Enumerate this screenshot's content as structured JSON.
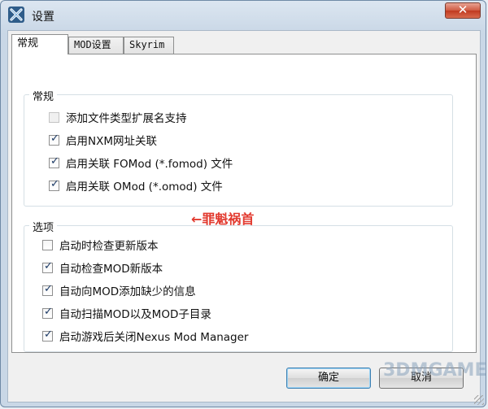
{
  "window": {
    "title": "设置",
    "close_symbol": "✕",
    "icon": "nexus-x-icon"
  },
  "tabs": [
    {
      "label": "常规",
      "active": true
    },
    {
      "label": "MOD设置",
      "active": false
    },
    {
      "label": "Skyrim",
      "active": false
    }
  ],
  "general_group": {
    "title": "常规",
    "items": [
      {
        "label": "添加文件类型扩展名支持",
        "checked": false,
        "enabled": false
      },
      {
        "label": "启用NXM网址关联",
        "checked": true,
        "enabled": true
      },
      {
        "label": "启用关联 FOMod (*.fomod) 文件",
        "checked": true,
        "enabled": true
      },
      {
        "label": "启用关联 OMod (*.omod) 文件",
        "checked": true,
        "enabled": true
      }
    ]
  },
  "options_group": {
    "title": "选项",
    "items": [
      {
        "label": "启动时检查更新版本",
        "checked": false
      },
      {
        "label": "自动检查MOD新版本",
        "checked": true
      },
      {
        "label": "自动向MOD添加缺少的信息",
        "checked": true
      },
      {
        "label": "自动扫描MOD以及MOD子目录",
        "checked": true
      },
      {
        "label": "启动游戏后关闭Nexus Mod Manager",
        "checked": true
      }
    ]
  },
  "annotation": "←罪魁祸首",
  "buttons": {
    "ok": "确定",
    "cancel": "取消"
  },
  "watermark": "3DMGAME",
  "colors": {
    "annotation": "#e23b30",
    "close_button": "#c0391f"
  }
}
